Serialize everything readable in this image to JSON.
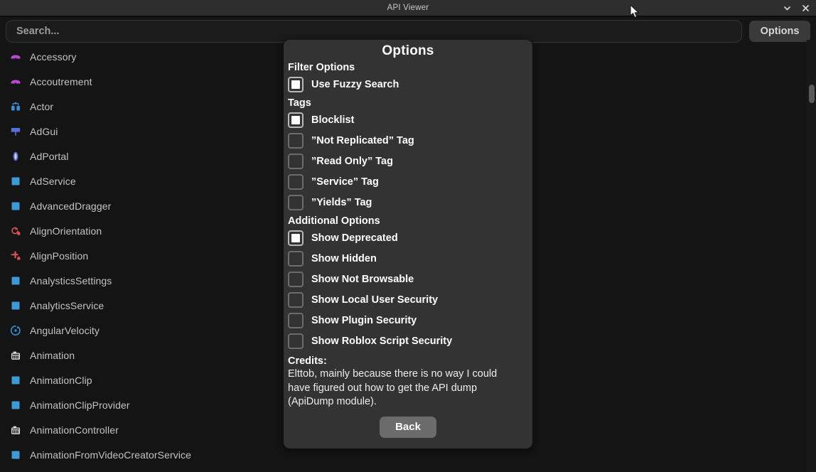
{
  "window": {
    "title": "API Viewer",
    "minimize_icon": "chevron-down-icon",
    "close_icon": "close-icon"
  },
  "search": {
    "placeholder": "Search...",
    "value": "",
    "options_label": "Options"
  },
  "list": {
    "items": [
      {
        "label": "Accessory",
        "icon": "accessory-glasses-icon",
        "color": "#b84ad1"
      },
      {
        "label": "Accoutrement",
        "icon": "accessory-glasses-icon",
        "color": "#b84ad1"
      },
      {
        "label": "Actor",
        "icon": "actor-icon",
        "color": "#3a8fd4"
      },
      {
        "label": "AdGui",
        "icon": "adgui-billboard-icon",
        "color": "#5b6fd8"
      },
      {
        "label": "AdPortal",
        "icon": "adportal-icon",
        "color": "#5b6fd8"
      },
      {
        "label": "AdService",
        "icon": "service-square-icon",
        "color": "#3c9ad6"
      },
      {
        "label": "AdvancedDragger",
        "icon": "service-square-icon",
        "color": "#3c9ad6"
      },
      {
        "label": "AlignOrientation",
        "icon": "align-orientation-icon",
        "color": "#d9534f"
      },
      {
        "label": "AlignPosition",
        "icon": "align-position-icon",
        "color": "#d9534f"
      },
      {
        "label": "AnalysticsSettings",
        "icon": "service-square-icon",
        "color": "#3c9ad6"
      },
      {
        "label": "AnalyticsService",
        "icon": "service-square-icon",
        "color": "#3c9ad6"
      },
      {
        "label": "AngularVelocity",
        "icon": "angular-velocity-icon",
        "color": "#2f8fd0"
      },
      {
        "label": "Animation",
        "icon": "animation-film-icon",
        "color": "#d5d5d5"
      },
      {
        "label": "AnimationClip",
        "icon": "service-square-icon",
        "color": "#3c9ad6"
      },
      {
        "label": "AnimationClipProvider",
        "icon": "service-square-icon",
        "color": "#3c9ad6"
      },
      {
        "label": "AnimationController",
        "icon": "animation-film-icon",
        "color": "#d5d5d5"
      },
      {
        "label": "AnimationFromVideoCreatorService",
        "icon": "service-square-icon",
        "color": "#3c9ad6"
      }
    ]
  },
  "dialog": {
    "title": "Options",
    "sections": [
      {
        "heading": "Filter Options",
        "options": [
          {
            "label": "Use Fuzzy Search",
            "state": "active"
          }
        ]
      },
      {
        "heading": "Tags",
        "options": [
          {
            "label": "Blocklist",
            "state": "active"
          },
          {
            "label": "”Not Replicated” Tag",
            "state": "inactive"
          },
          {
            "label": "”Read Only” Tag",
            "state": "inactive"
          },
          {
            "label": "”Service” Tag",
            "state": "inactive"
          },
          {
            "label": "”Yields” Tag",
            "state": "inactive"
          }
        ]
      },
      {
        "heading": "Additional Options",
        "options": [
          {
            "label": "Show Deprecated",
            "state": "active"
          },
          {
            "label": "Show Hidden",
            "state": "inactive"
          },
          {
            "label": "Show Not Browsable",
            "state": "inactive"
          },
          {
            "label": "Show Local User Security",
            "state": "inactive"
          },
          {
            "label": "Show Plugin Security",
            "state": "inactive"
          },
          {
            "label": "Show Roblox Script Security",
            "state": "inactive"
          }
        ]
      }
    ],
    "credits_heading": "Credits:",
    "credits_body": " Elttob, mainly because there is no way I could have figured out how to get the API dump (ApiDump module).",
    "back_label": "Back"
  },
  "colors": {
    "window_bg": "#151515",
    "titlebar_bg": "#2e2e2e",
    "dialog_bg": "#333333",
    "accent_button": "#6b6b6b",
    "text_primary": "#ffffff",
    "text_secondary": "#c3c3c3"
  }
}
